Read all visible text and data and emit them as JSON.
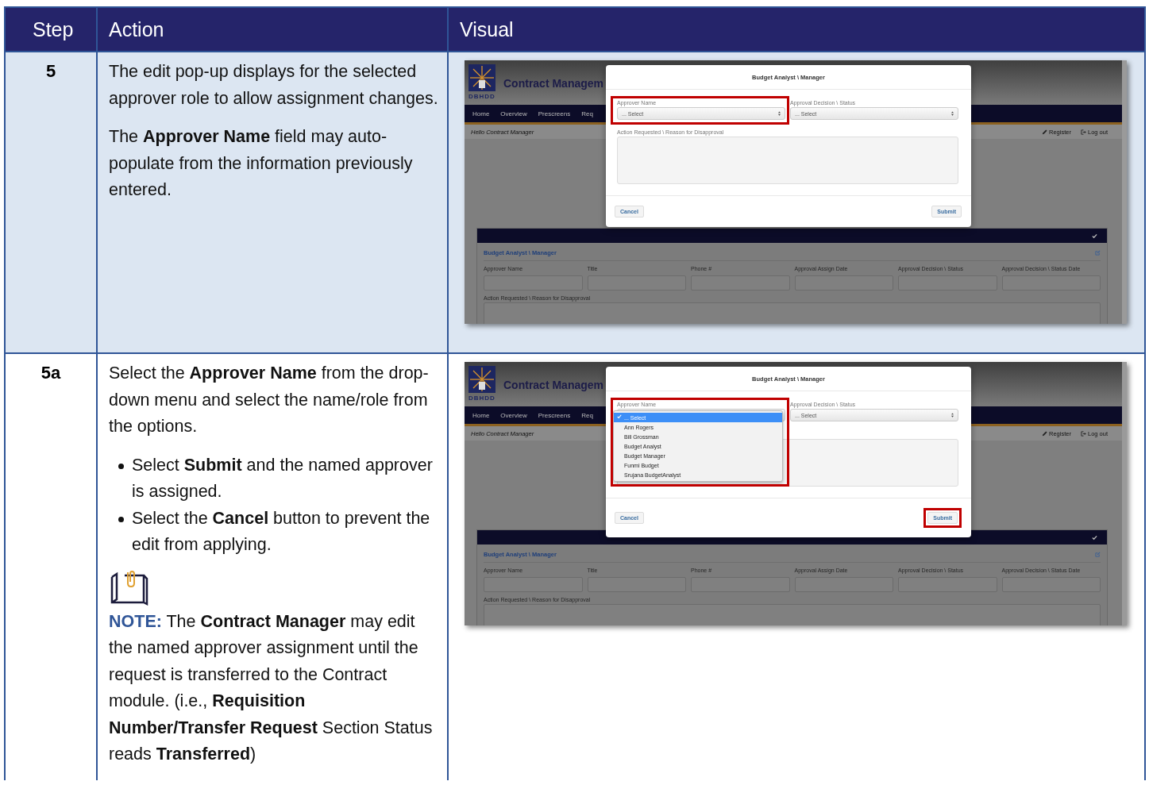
{
  "table": {
    "columns": [
      "Step",
      "Action",
      "Visual"
    ],
    "rows": [
      {
        "step": "5",
        "shaded": true,
        "action": [
          {
            "kind": "paragraph",
            "text": "The edit pop-up displays for the selected approver role to allow assignment changes."
          },
          {
            "kind": "paragraph",
            "text": "The **Approver Name** field may auto-populate from the information previously entered."
          }
        ],
        "visual": {
          "app_title": "Contract Managem",
          "logo_text": "DBHDD",
          "nav": [
            "Home",
            "Overview",
            "Prescreens",
            "Req"
          ],
          "greeting": "Hello Contract Manager",
          "user_links": [
            {
              "label": "Register",
              "kind": "register"
            },
            {
              "label": "Log out",
              "kind": "logout"
            }
          ],
          "panel": {
            "section_title": "Budget Analyst \\ Manager",
            "field_labels": [
              "Approver Name",
              "Title",
              "Phone #",
              "Approval Assign Date",
              "Approval Decision \\ Status",
              "Approval Decision \\ Status Date"
            ],
            "textarea_label": "Action Requested \\ Reason for Disapproval"
          },
          "modal": {
            "title": "Budget Analyst \\ Manager",
            "fields": [
              {
                "label": "Approver Name",
                "value": "... Select",
                "highlighted": true
              },
              {
                "label": "Approval Decision \\ Status",
                "value": "... Select",
                "highlighted": false
              }
            ],
            "textarea_label": "Action Requested \\ Reason for Disapproval",
            "buttons": [
              {
                "label": "Cancel",
                "highlighted": false
              },
              {
                "label": "Submit",
                "highlighted": false
              }
            ]
          }
        }
      },
      {
        "step": "5a",
        "shaded": false,
        "action": [
          {
            "kind": "paragraph",
            "text": "Select the **Approver Name** from the drop-down menu and select the name/role from the options."
          },
          {
            "kind": "bullets",
            "items": [
              "Select **Submit** and the named approver is assigned.",
              "Select the **Cancel** button to prevent the edit from applying."
            ]
          },
          {
            "kind": "note",
            "label": "NOTE:",
            "text": "The **Contract Manager** may edit the named approver assignment until the request is transferred to the Contract module. (i.e., **Requisition Number/Transfer Request** Section Status reads **Transferred**)"
          }
        ],
        "visual": {
          "app_title": "Contract Managem",
          "logo_text": "DBHDD",
          "nav": [
            "Home",
            "Overview",
            "Prescreens",
            "Req"
          ],
          "greeting": "Hello Contract Manager",
          "user_links": [
            {
              "label": "Register",
              "kind": "register"
            },
            {
              "label": "Log out",
              "kind": "logout"
            }
          ],
          "panel": {
            "section_title": "Budget Analyst \\ Manager",
            "field_labels": [
              "Approver Name",
              "Title",
              "Phone #",
              "Approval Assign Date",
              "Approval Decision \\ Status",
              "Approval Decision \\ Status Date"
            ],
            "textarea_label": "Action Requested \\ Reason for Disapproval"
          },
          "modal": {
            "title": "Budget Analyst \\ Manager",
            "fields": [
              {
                "label": "Approver Name",
                "highlighted": true,
                "options": [
                  {
                    "label": "... Select",
                    "selected": true
                  },
                  {
                    "label": "Ann Rogers",
                    "selected": false
                  },
                  {
                    "label": "Bill Grossman",
                    "selected": false
                  },
                  {
                    "label": "Budget Analyst",
                    "selected": false
                  },
                  {
                    "label": "Budget Manager",
                    "selected": false
                  },
                  {
                    "label": "Funmi Budget",
                    "selected": false
                  },
                  {
                    "label": "Srujana BudgetAnalyst",
                    "selected": false
                  }
                ]
              },
              {
                "label": "Approval Decision \\ Status",
                "value": "... Select",
                "highlighted": false
              }
            ],
            "buttons": [
              {
                "label": "Cancel",
                "highlighted": false
              },
              {
                "label": "Submit",
                "highlighted": true
              }
            ]
          }
        }
      }
    ]
  }
}
